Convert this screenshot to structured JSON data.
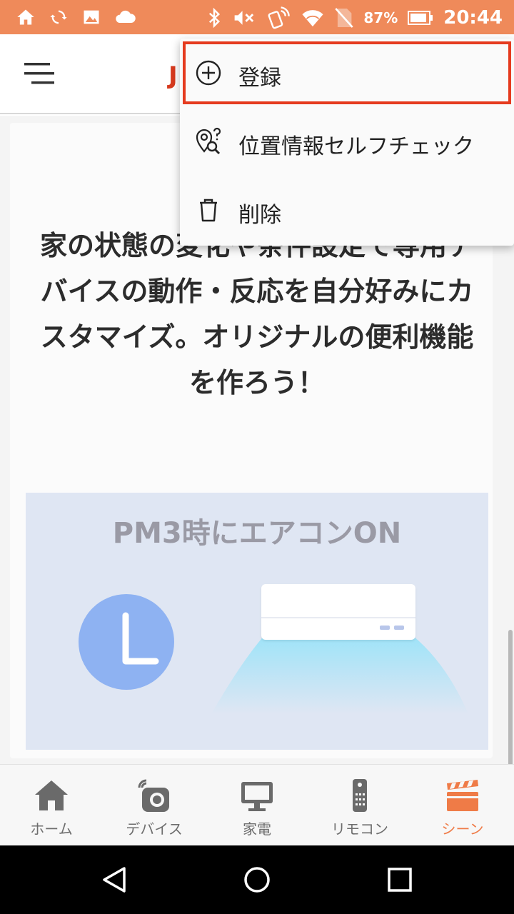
{
  "status_bar": {
    "battery_percent": "87%",
    "time": "20:44",
    "icons": [
      "home-icon",
      "sync-icon",
      "image-icon",
      "cloud-icon",
      "bluetooth-icon",
      "mute-icon",
      "nfc-icon",
      "wifi-icon",
      "no-sim-icon",
      "battery-icon"
    ]
  },
  "app_bar": {
    "title_fragment": "J"
  },
  "content": {
    "headline": "家の状態の変化や条件設定で専用デバイスの動作・反応を自分好みにカスタマイズ。オリジナルの便利機能を作ろう！",
    "illustration_caption": "PM3時にエアコンON"
  },
  "popup_menu": {
    "items": [
      {
        "label": "登録",
        "icon": "add-circle-icon",
        "highlighted": true
      },
      {
        "label": "位置情報セルフチェック",
        "icon": "location-check-icon"
      },
      {
        "label": "削除",
        "icon": "trash-icon"
      }
    ]
  },
  "bottom_nav": {
    "items": [
      {
        "label": "ホーム",
        "icon": "home-icon"
      },
      {
        "label": "デバイス",
        "icon": "device-icon"
      },
      {
        "label": "家電",
        "icon": "monitor-icon"
      },
      {
        "label": "リモコン",
        "icon": "remote-icon"
      },
      {
        "label": "シーン",
        "icon": "scene-icon",
        "active": true
      }
    ]
  },
  "colors": {
    "status_bar": "#ef8a5a",
    "accent": "#ef7b47",
    "highlight_border": "#e53b1f"
  }
}
